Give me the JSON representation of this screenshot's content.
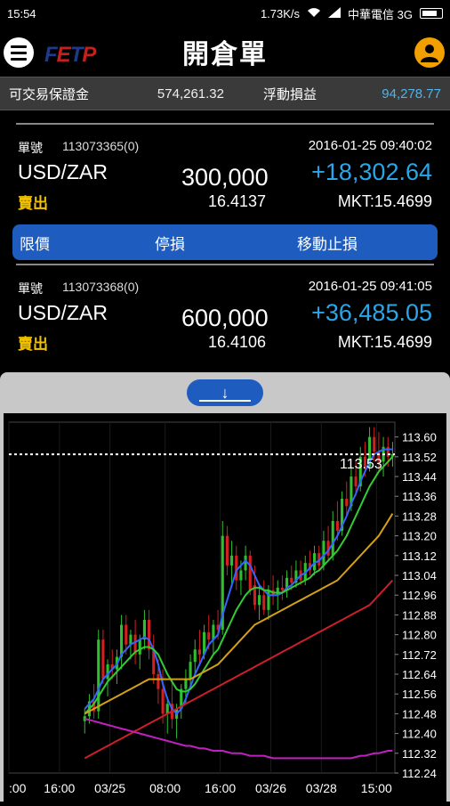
{
  "status_bar": {
    "time": "15:54",
    "speed": "1.73K/s",
    "carrier": "中華電信 3G"
  },
  "header": {
    "logo": "FETP",
    "title": "開倉單",
    "menu_icon": "hamburger-menu-icon",
    "account_icon": "user-avatar-icon",
    "accent": "#f2a000"
  },
  "summary": {
    "margin_label": "可交易保證金",
    "margin_value": "574,261.32",
    "float_label": "浮動損益",
    "float_value": "94,278.77"
  },
  "orders": [
    {
      "ticket_label": "單號",
      "ticket": "113073365(0)",
      "time": "2016-01-25 09:40:02",
      "pair": "USD/ZAR",
      "quantity": "300,000",
      "pnl": "+18,302.64",
      "side": "賣出",
      "open_price": "16.4137",
      "market": "MKT:15.4699"
    },
    {
      "ticket_label": "單號",
      "ticket": "113073368(0)",
      "time": "2016-01-25 09:41:05",
      "pair": "USD/ZAR",
      "quantity": "600,000",
      "pnl": "+36,485.05",
      "side": "賣出",
      "open_price": "16.4106",
      "market": "MKT:15.4699"
    }
  ],
  "order_actions": {
    "limit": "限價",
    "stop": "停損",
    "trailing": "移動止損"
  },
  "panel": {
    "collapse_icon": "arrow-down-icon",
    "collapse_glyph": "↓"
  },
  "chart_data": {
    "type": "candlestick",
    "current_price": "113.53",
    "current_value": 113.53,
    "ylim": [
      112.24,
      113.66
    ],
    "y_ticks": [
      "113.60",
      "113.52",
      "113.44",
      "113.36",
      "113.28",
      "113.20",
      "113.12",
      "113.04",
      "112.96",
      "112.88",
      "112.80",
      "112.72",
      "112.64",
      "112.56",
      "112.48",
      "112.40",
      "112.32",
      "112.24"
    ],
    "x_ticks": [
      ":00",
      "16:00",
      "03/25",
      "08:00",
      "16:00",
      "03/26",
      "03/28",
      "15:00"
    ],
    "x_tick_positions": [
      0,
      11,
      22,
      34,
      46,
      57,
      68,
      80
    ],
    "count": 84,
    "colors": {
      "up": "#2fbf2f",
      "down": "#d42020",
      "ma1": "#3366ff",
      "ma2": "#33cc33",
      "ma3": "#d4a017",
      "ma4": "#cc1f2a",
      "ma5": "#c020c0"
    },
    "candles": [
      [
        112.45,
        112.5,
        112.4,
        112.47
      ],
      [
        112.47,
        112.56,
        112.44,
        112.53
      ],
      [
        112.53,
        112.6,
        112.46,
        112.49
      ],
      [
        112.49,
        112.82,
        112.46,
        112.78
      ],
      [
        112.78,
        112.82,
        112.6,
        112.62
      ],
      [
        112.62,
        112.7,
        112.55,
        112.68
      ],
      [
        112.68,
        112.74,
        112.62,
        112.66
      ],
      [
        112.66,
        112.74,
        112.6,
        112.71
      ],
      [
        112.71,
        112.88,
        112.66,
        112.84
      ],
      [
        112.84,
        112.88,
        112.72,
        112.76
      ],
      [
        112.76,
        112.82,
        112.7,
        112.8
      ],
      [
        112.8,
        112.86,
        112.68,
        112.72
      ],
      [
        112.72,
        112.8,
        112.66,
        112.78
      ],
      [
        112.78,
        112.9,
        112.74,
        112.86
      ],
      [
        112.86,
        112.9,
        112.7,
        112.74
      ],
      [
        112.74,
        112.8,
        112.6,
        112.64
      ],
      [
        112.64,
        112.7,
        112.52,
        112.58
      ],
      [
        112.58,
        112.66,
        112.44,
        112.48
      ],
      [
        112.48,
        112.55,
        112.4,
        112.52
      ],
      [
        112.52,
        112.62,
        112.42,
        112.46
      ],
      [
        112.46,
        112.52,
        112.38,
        112.5
      ],
      [
        112.5,
        112.6,
        112.46,
        112.58
      ],
      [
        112.58,
        112.66,
        112.52,
        112.62
      ],
      [
        112.62,
        112.72,
        112.58,
        112.69
      ],
      [
        112.69,
        112.78,
        112.64,
        112.74
      ],
      [
        112.74,
        112.82,
        112.68,
        112.72
      ],
      [
        112.72,
        112.84,
        112.7,
        112.81
      ],
      [
        112.81,
        112.88,
        112.74,
        112.78
      ],
      [
        112.78,
        112.86,
        112.72,
        112.84
      ],
      [
        112.84,
        112.9,
        112.78,
        112.82
      ],
      [
        112.82,
        113.26,
        112.8,
        113.2
      ],
      [
        113.2,
        113.24,
        113.04,
        113.08
      ],
      [
        113.08,
        113.18,
        113.0,
        113.12
      ],
      [
        113.12,
        113.16,
        112.98,
        113.02
      ],
      [
        113.02,
        113.1,
        112.96,
        113.06
      ],
      [
        113.06,
        113.16,
        113.02,
        113.12
      ],
      [
        113.12,
        113.14,
        112.96,
        112.98
      ],
      [
        113.0,
        113.08,
        112.9,
        112.92
      ],
      [
        112.92,
        113.0,
        112.86,
        112.96
      ],
      [
        112.96,
        113.02,
        112.88,
        112.9
      ],
      [
        112.9,
        113.0,
        112.86,
        112.98
      ],
      [
        112.98,
        113.04,
        112.92,
        112.96
      ],
      [
        112.96,
        113.02,
        112.9,
        112.99
      ],
      [
        112.99,
        113.04,
        112.94,
        112.98
      ],
      [
        112.98,
        113.06,
        112.95,
        113.03
      ],
      [
        113.03,
        113.08,
        112.98,
        113.01
      ],
      [
        113.01,
        113.1,
        112.99,
        113.06
      ],
      [
        113.06,
        113.1,
        113.0,
        113.02
      ],
      [
        113.02,
        113.12,
        113.0,
        113.09
      ],
      [
        113.09,
        113.14,
        113.04,
        113.06
      ],
      [
        113.06,
        113.16,
        113.04,
        113.13
      ],
      [
        113.13,
        113.16,
        113.06,
        113.08
      ],
      [
        113.08,
        113.22,
        113.06,
        113.18
      ],
      [
        113.18,
        113.24,
        113.1,
        113.12
      ],
      [
        113.12,
        113.3,
        113.1,
        113.26
      ],
      [
        113.26,
        113.34,
        113.18,
        113.22
      ],
      [
        113.22,
        113.38,
        113.2,
        113.35
      ],
      [
        113.35,
        113.42,
        113.28,
        113.32
      ],
      [
        113.32,
        113.48,
        113.3,
        113.44
      ],
      [
        113.44,
        113.5,
        113.36,
        113.4
      ],
      [
        113.4,
        113.56,
        113.38,
        113.52
      ],
      [
        113.52,
        113.58,
        113.44,
        113.48
      ],
      [
        113.48,
        113.64,
        113.46,
        113.6
      ],
      [
        113.6,
        113.64,
        113.5,
        113.54
      ],
      [
        113.54,
        113.62,
        113.46,
        113.5
      ],
      [
        113.5,
        113.6,
        113.44,
        113.56
      ],
      [
        113.56,
        113.6,
        113.48,
        113.52
      ],
      [
        113.52,
        113.58,
        113.48,
        113.53
      ]
    ],
    "ma_series": [
      {
        "key": "ma1",
        "values": [
          112.5,
          112.52,
          112.54,
          112.58,
          112.62,
          112.64,
          112.66,
          112.68,
          112.72,
          112.74,
          112.76,
          112.77,
          112.78,
          112.79,
          112.78,
          112.74,
          112.68,
          112.6,
          112.54,
          112.5,
          112.48,
          112.5,
          112.54,
          112.59,
          112.64,
          112.68,
          112.72,
          112.76,
          112.78,
          112.8,
          112.88,
          112.94,
          113.0,
          113.06,
          113.08,
          113.1,
          113.08,
          113.04,
          113.0,
          112.98,
          112.96,
          112.96,
          112.96,
          112.97,
          112.99,
          113.0,
          113.02,
          113.04,
          113.05,
          113.07,
          113.09,
          113.1,
          113.12,
          113.14,
          113.17,
          113.2,
          113.24,
          113.28,
          113.33,
          113.37,
          113.42,
          113.46,
          113.5,
          113.53,
          113.54,
          113.55,
          113.55,
          113.55
        ]
      },
      {
        "key": "ma2",
        "values": [
          112.48,
          112.5,
          112.52,
          112.55,
          112.58,
          112.61,
          112.63,
          112.65,
          112.67,
          112.69,
          112.71,
          112.73,
          112.74,
          112.75,
          112.75,
          112.74,
          112.72,
          112.68,
          112.64,
          112.61,
          112.58,
          112.57,
          112.57,
          112.58,
          112.6,
          112.63,
          112.66,
          112.69,
          112.72,
          112.74,
          112.78,
          112.82,
          112.86,
          112.9,
          112.93,
          112.96,
          112.98,
          112.99,
          112.99,
          112.98,
          112.98,
          112.97,
          112.97,
          112.97,
          112.98,
          112.99,
          113.0,
          113.01,
          113.02,
          113.03,
          113.05,
          113.06,
          113.08,
          113.1,
          113.12,
          113.14,
          113.17,
          113.2,
          113.24,
          113.28,
          113.32,
          113.36,
          113.4,
          113.43,
          113.46,
          113.48,
          113.5,
          113.52
        ]
      },
      {
        "key": "ma3",
        "values": [
          112.48,
          112.49,
          112.5,
          112.51,
          112.52,
          112.53,
          112.54,
          112.55,
          112.56,
          112.57,
          112.58,
          112.59,
          112.6,
          112.61,
          112.62,
          112.62,
          112.62,
          112.62,
          112.62,
          112.62,
          112.62,
          112.62,
          112.62,
          112.62,
          112.63,
          112.64,
          112.65,
          112.66,
          112.67,
          112.68,
          112.7,
          112.72,
          112.74,
          112.76,
          112.78,
          112.8,
          112.82,
          112.84,
          112.85,
          112.86,
          112.87,
          112.88,
          112.89,
          112.9,
          112.91,
          112.92,
          112.93,
          112.94,
          112.95,
          112.96,
          112.97,
          112.98,
          112.99,
          113.0,
          113.01,
          113.02,
          113.04,
          113.06,
          113.08,
          113.1,
          113.12,
          113.14,
          113.16,
          113.18,
          113.2,
          113.23,
          113.26,
          113.29
        ]
      },
      {
        "key": "ma4",
        "values": [
          112.3,
          112.31,
          112.32,
          112.33,
          112.34,
          112.35,
          112.36,
          112.37,
          112.38,
          112.39,
          112.4,
          112.41,
          112.42,
          112.43,
          112.44,
          112.45,
          112.46,
          112.47,
          112.48,
          112.49,
          112.5,
          112.51,
          112.52,
          112.53,
          112.54,
          112.55,
          112.56,
          112.57,
          112.58,
          112.59,
          112.6,
          112.61,
          112.62,
          112.63,
          112.64,
          112.65,
          112.66,
          112.67,
          112.68,
          112.69,
          112.7,
          112.71,
          112.72,
          112.73,
          112.74,
          112.75,
          112.76,
          112.77,
          112.78,
          112.79,
          112.8,
          112.81,
          112.82,
          112.83,
          112.84,
          112.85,
          112.86,
          112.87,
          112.88,
          112.89,
          112.9,
          112.91,
          112.92,
          112.94,
          112.96,
          112.98,
          113.0,
          113.02
        ]
      },
      {
        "key": "ma5",
        "values": [
          112.46,
          112.455,
          112.45,
          112.445,
          112.44,
          112.435,
          112.43,
          112.425,
          112.42,
          112.415,
          112.41,
          112.405,
          112.4,
          112.395,
          112.39,
          112.385,
          112.38,
          112.375,
          112.37,
          112.365,
          112.36,
          112.355,
          112.35,
          112.35,
          112.345,
          112.34,
          112.34,
          112.335,
          112.33,
          112.33,
          112.33,
          112.325,
          112.32,
          112.32,
          112.32,
          112.315,
          112.31,
          112.31,
          112.31,
          112.31,
          112.305,
          112.3,
          112.3,
          112.3,
          112.3,
          112.3,
          112.3,
          112.3,
          112.3,
          112.3,
          112.3,
          112.3,
          112.3,
          112.3,
          112.3,
          112.3,
          112.3,
          112.3,
          112.3,
          112.305,
          112.31,
          112.31,
          112.315,
          112.32,
          112.32,
          112.325,
          112.33,
          112.33
        ]
      }
    ]
  }
}
